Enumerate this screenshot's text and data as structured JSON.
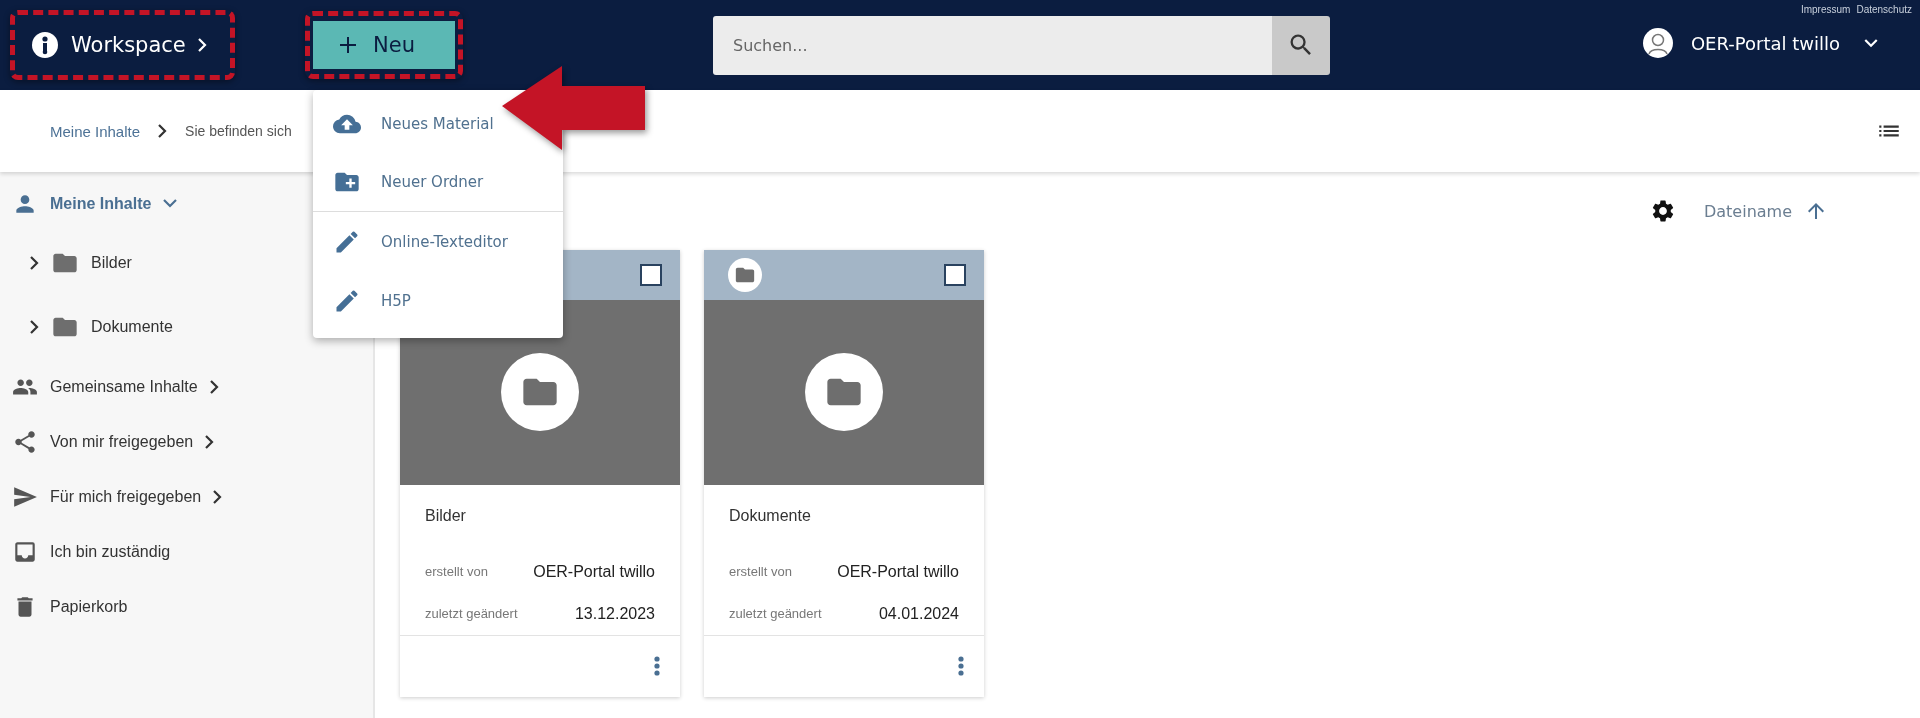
{
  "header": {
    "workspace": {
      "label": "Workspace",
      "highlighted": true
    },
    "new_button": {
      "label": "Neu",
      "highlighted": true
    },
    "search": {
      "placeholder": "Suchen..."
    },
    "links": [
      "Impressum",
      "Datenschutz"
    ],
    "user": {
      "name": "OER-Portal twillo"
    }
  },
  "new_menu": {
    "items": [
      {
        "label": "Neues Material",
        "divider_after": false,
        "pointed": true
      },
      {
        "label": "Neuer Ordner",
        "divider_after": true,
        "pointed": false
      },
      {
        "label": "Online-Texteditor",
        "divider_after": false,
        "pointed": false
      },
      {
        "label": "H5P",
        "divider_after": false,
        "pointed": false
      }
    ]
  },
  "breadcrumb": [
    "Meine Inhalte",
    "Sie befinden sich"
  ],
  "sidebar": {
    "items": [
      {
        "label": "Meine Inhalte",
        "selected": true,
        "expanded": true,
        "children": [
          {
            "label": "Bilder",
            "expanded": false
          },
          {
            "label": "Dokumente",
            "expanded": false
          }
        ]
      },
      {
        "label": "Gemeinsame Inhalte",
        "selected": false,
        "expanded": false
      },
      {
        "label": "Von mir freigegeben",
        "selected": false,
        "expanded": false
      },
      {
        "label": "Für mich freigegeben",
        "selected": false,
        "expanded": false
      },
      {
        "label": "Ich bin zuständig",
        "selected": false
      },
      {
        "label": "Papierkorb",
        "selected": false
      }
    ]
  },
  "sort": {
    "label": "Dateiname"
  },
  "cards": [
    {
      "title": "Bilder",
      "checked": false,
      "meta": [
        {
          "label": "erstellt von",
          "value": "OER-Portal twillo"
        },
        {
          "label": "zuletzt geändert",
          "value": "13.12.2023"
        }
      ]
    },
    {
      "title": "Dokumente",
      "checked": false,
      "meta": [
        {
          "label": "erstellt von",
          "value": "OER-Portal twillo"
        },
        {
          "label": "zuletzt geändert",
          "value": "04.01.2024"
        }
      ]
    }
  ]
}
